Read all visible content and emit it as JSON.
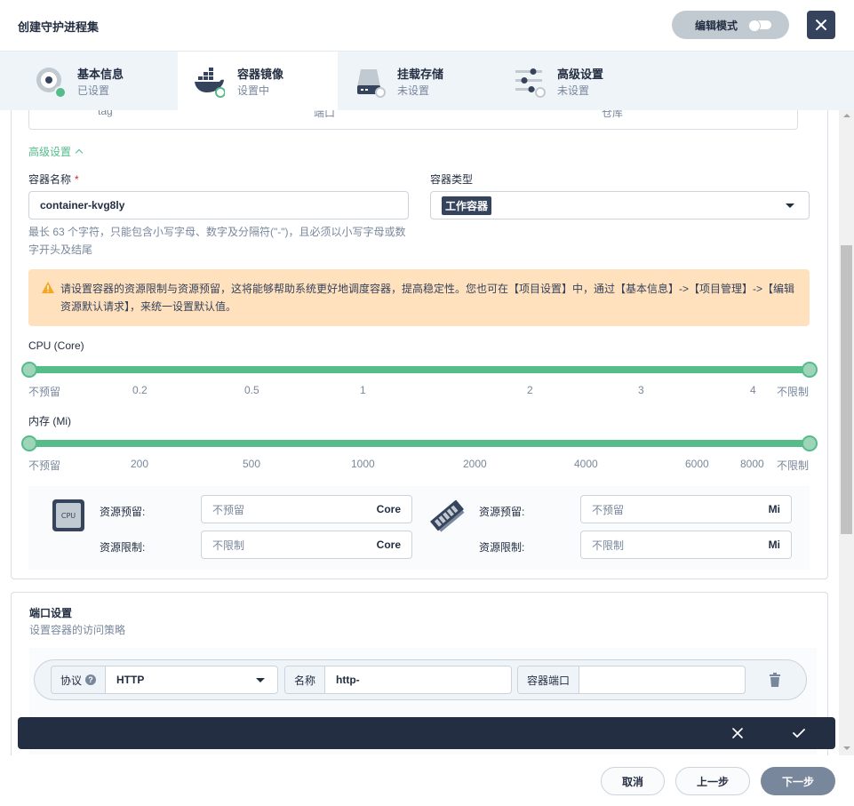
{
  "header": {
    "title": "创建守护进程集",
    "edit_mode": "编辑模式"
  },
  "tabs": [
    {
      "name": "基本信息",
      "state": "已设置",
      "icon": "settings-disc-icon"
    },
    {
      "name": "容器镜像",
      "state": "设置中",
      "icon": "docker-icon"
    },
    {
      "name": "挂载存储",
      "state": "未设置",
      "icon": "storage-icon"
    },
    {
      "name": "高级设置",
      "state": "未设置",
      "icon": "sliders-icon"
    }
  ],
  "image_summary": {
    "tag": "tag",
    "port": "端口",
    "registry": "仓库"
  },
  "advanced_toggle": "高级设置",
  "container_name": {
    "label": "容器名称",
    "required_mark": "*",
    "value": "container-kvg8ly",
    "hint": "最长 63 个字符，只能包含小写字母、数字及分隔符(\"-\")，且必须以小写字母或数字开头及结尾"
  },
  "container_type": {
    "label": "容器类型",
    "value": "工作容器"
  },
  "warning": "请设置容器的资源限制与资源预留，这将能够帮助系统更好地调度容器，提高稳定性。您也可在【项目设置】中，通过【基本信息】->【项目管理】->【编辑资源默认请求】，来统一设置默认值。",
  "cpu_slider": {
    "label": "CPU (Core)",
    "ticks": [
      "不预留",
      "0.2",
      "0.5",
      "1",
      "2",
      "3",
      "4",
      "不限制"
    ],
    "range_fraction": [
      0,
      1
    ]
  },
  "mem_slider": {
    "label": "内存 (Mi)",
    "ticks": [
      "不预留",
      "200",
      "500",
      "1000",
      "2000",
      "4000",
      "6000",
      "8000",
      "不限制"
    ],
    "range_fraction": [
      0,
      1
    ]
  },
  "resources": {
    "cpu_icon_text": "CPU",
    "request_label": "资源预留:",
    "limit_label": "资源限制:",
    "cpu_request_placeholder": "不预留",
    "cpu_limit_placeholder": "不限制",
    "cpu_unit": "Core",
    "mem_request_placeholder": "不预留",
    "mem_limit_placeholder": "不限制",
    "mem_unit": "Mi"
  },
  "ports": {
    "title": "端口设置",
    "subtitle": "设置容器的访问策略",
    "protocol_label": "协议",
    "protocol_value": "HTTP",
    "name_label": "名称",
    "name_value": "http-",
    "container_port_label": "容器端口",
    "container_port_value": ""
  },
  "footer": {
    "cancel": "取消",
    "prev": "上一步",
    "next": "下一步"
  },
  "colors": {
    "accent": "#55bc8a",
    "dark": "#242e42",
    "warning_bg": "#ffe1be"
  }
}
